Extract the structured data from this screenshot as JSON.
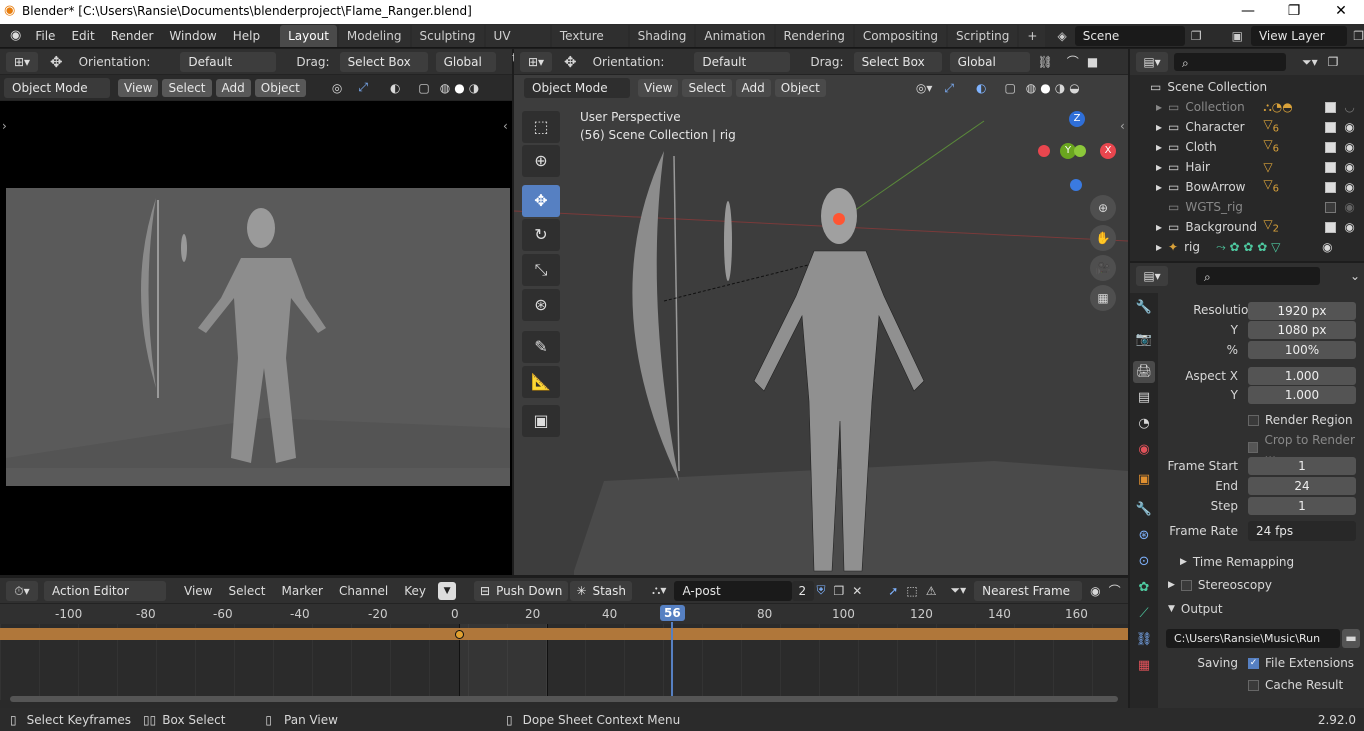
{
  "window": {
    "title": "Blender* [C:\\Users\\Ransie\\Documents\\blenderproject\\Flame_Ranger.blend]",
    "min": "—",
    "max": "❐",
    "close": "✕"
  },
  "menus": [
    "File",
    "Edit",
    "Render",
    "Window",
    "Help"
  ],
  "workspaces": [
    "Layout",
    "Modeling",
    "Sculpting",
    "UV Editing",
    "Texture Paint",
    "Shading",
    "Animation",
    "Rendering",
    "Compositing",
    "Scripting"
  ],
  "add_tab": "+",
  "scene": "Scene",
  "view_layer": "View Layer",
  "left_header": {
    "orientation_label": "Orientation:",
    "orientation": "Default",
    "drag_label": "Drag:",
    "drag": "Select Box",
    "transform": "Global"
  },
  "left_view": {
    "mode": "Object Mode",
    "menus": [
      "View",
      "Select",
      "Add",
      "Object"
    ]
  },
  "right_header": {
    "orientation_label": "Orientation:",
    "orientation": "Default",
    "drag_label": "Drag:",
    "drag": "Select Box",
    "transform": "Global"
  },
  "right_view": {
    "mode": "Object Mode",
    "menus": [
      "View",
      "Select",
      "Add",
      "Object"
    ],
    "overlay_title": "User Perspective",
    "overlay_sub": "(56) Scene Collection | rig"
  },
  "gizmo": {
    "x": "X",
    "y": "Y",
    "z": "Z"
  },
  "outliner": {
    "root": "Scene Collection",
    "items": [
      {
        "name": "Collection",
        "dim": true,
        "badge": "4"
      },
      {
        "name": "Character",
        "dim": false,
        "badge": "6"
      },
      {
        "name": "Cloth",
        "dim": false,
        "badge": "6"
      },
      {
        "name": "Hair",
        "dim": false,
        "badge": ""
      },
      {
        "name": "BowArrow",
        "dim": false,
        "badge": "6"
      },
      {
        "name": "WGTS_rig",
        "dim": true,
        "badge": ""
      },
      {
        "name": "Background",
        "dim": false,
        "badge": "2"
      },
      {
        "name": "rig",
        "dim": false,
        "badge": ""
      }
    ]
  },
  "properties": {
    "resolution_x_label": "Resolution X",
    "resolution_x": "1920 px",
    "y_label": "Y",
    "resolution_y": "1080 px",
    "pct_label": "%",
    "pct": "100%",
    "aspect_x_label": "Aspect X",
    "aspect_x": "1.000",
    "aspect_y_label": "Y",
    "aspect_y": "1.000",
    "render_region": "Render Region",
    "crop": "Crop to Render ...",
    "frame_start_label": "Frame Start",
    "frame_start": "1",
    "end_label": "End",
    "end": "24",
    "step_label": "Step",
    "step": "1",
    "frame_rate_label": "Frame Rate",
    "frame_rate": "24 fps",
    "time_remapping": "Time Remapping",
    "stereoscopy": "Stereoscopy",
    "output": "Output",
    "output_path": "C:\\Users\\Ransie\\Music\\Run",
    "saving_label": "Saving",
    "file_extensions": "File Extensions",
    "cache_result": "Cache Result"
  },
  "dopesheet": {
    "mode": "Action Editor",
    "menus": [
      "View",
      "Select",
      "Marker",
      "Channel",
      "Key"
    ],
    "push_down": "Push Down",
    "stash": "Stash",
    "action": "A-post",
    "users": "2",
    "snap": "Nearest Frame",
    "ticks": [
      "-100",
      "-80",
      "-60",
      "-40",
      "-20",
      "0",
      "20",
      "40",
      "60",
      "80",
      "100",
      "120",
      "140",
      "160"
    ],
    "current_frame": "56"
  },
  "statusbar": {
    "select": "Select Keyframes",
    "box": "Box Select",
    "pan": "Pan View",
    "context": "Dope Sheet Context Menu",
    "version": "2.92.0"
  },
  "colors": {
    "accent": "#5680c2",
    "action_strip": "#b0773a",
    "frame_line": "#5680c2",
    "keyframe": "#e0a030"
  }
}
